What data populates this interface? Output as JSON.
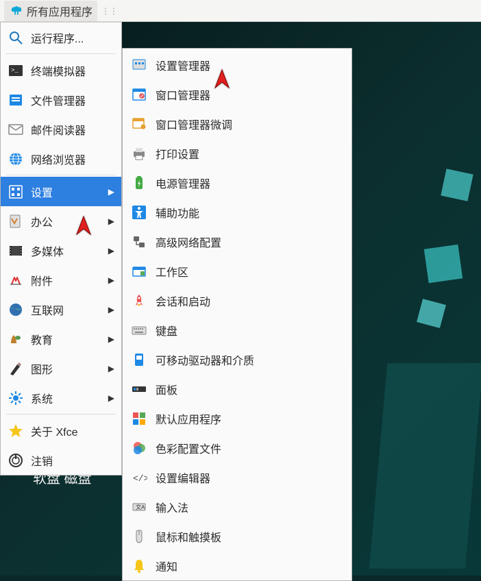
{
  "topbar": {
    "app_menu_label": "所有应用程序"
  },
  "main_menu": {
    "run_program": "运行程序...",
    "terminal": "终端模拟器",
    "file_manager": "文件管理器",
    "mail_reader": "邮件阅读器",
    "web_browser": "网络浏览器",
    "settings": "设置",
    "office": "办公",
    "multimedia": "多媒体",
    "accessories": "附件",
    "internet": "互联网",
    "education": "教育",
    "graphics": "图形",
    "system": "系统",
    "about_xfce": "关于 Xfce",
    "logout": "注销"
  },
  "submenu": {
    "settings_manager": "设置管理器",
    "window_manager": "窗口管理器",
    "window_manager_tweaks": "窗口管理器微调",
    "print_settings": "打印设置",
    "power_manager": "电源管理器",
    "accessibility": "辅助功能",
    "advanced_network": "高级网络配置",
    "workspaces": "工作区",
    "session_startup": "会话和启动",
    "keyboard": "键盘",
    "removable_media": "可移动驱动器和介质",
    "panel": "面板",
    "default_applications": "默认应用程序",
    "color_profiles": "色彩配置文件",
    "settings_editor": "设置编辑器",
    "input_method": "输入法",
    "mouse_touchpad": "鼠标和触摸板",
    "notifications": "通知"
  },
  "desktop": {
    "floppy_label": "软盘 磁盘"
  }
}
